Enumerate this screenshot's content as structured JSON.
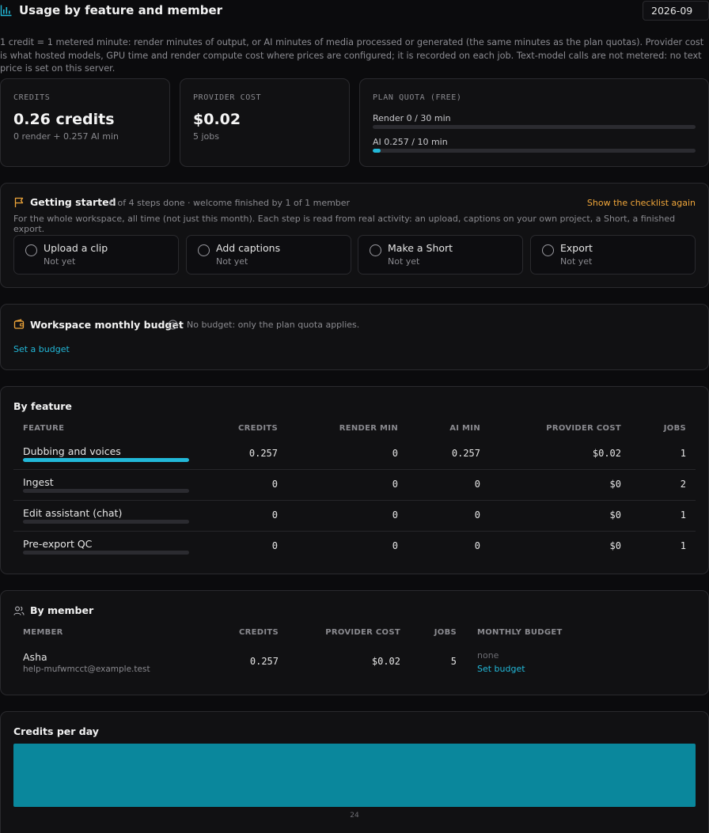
{
  "header": {
    "title": "Usage by feature and member",
    "month": "2026-09",
    "intro": "1 credit = 1 metered minute: render minutes of output, or AI minutes of media processed or generated (the same minutes as the plan quotas). Provider cost is what hosted models, GPU time and render compute cost where prices are configured; it is recorded on each job. Text-model calls are not metered: no text price is set on this server."
  },
  "stats": {
    "credits": {
      "caption": "CREDITS",
      "value": "0.26 credits",
      "sub": "0 render + 0.257 AI min"
    },
    "provider_cost": {
      "caption": "PROVIDER COST",
      "value": "$0.02",
      "sub": "5 jobs"
    },
    "plan_quota": {
      "caption": "PLAN QUOTA (FREE)",
      "render_label": "Render 0 / 30 min",
      "render_fraction": 0.0,
      "ai_label": "AI 0.257 / 10 min",
      "ai_fraction": 0.0257
    }
  },
  "getting_started": {
    "title": "Getting started",
    "progress": "0 of 4 steps done · welcome finished by 1 of 1 member",
    "show_link": "Show the checklist again",
    "description": "For the whole workspace, all time (not just this month). Each step is read from real activity: an upload, captions on your own project, a Short, a finished export.",
    "steps": [
      {
        "label": "Upload a clip",
        "status": "Not yet"
      },
      {
        "label": "Add captions",
        "status": "Not yet"
      },
      {
        "label": "Make a Short",
        "status": "Not yet"
      },
      {
        "label": "Export",
        "status": "Not yet"
      }
    ]
  },
  "budget": {
    "title": "Workspace monthly budget",
    "note": "No budget: only the plan quota applies.",
    "action": "Set a budget"
  },
  "by_feature": {
    "title": "By feature",
    "columns": [
      "FEATURE",
      "CREDITS",
      "RENDER MIN",
      "AI MIN",
      "PROVIDER COST",
      "JOBS"
    ],
    "rows": [
      {
        "feature": "Dubbing and voices",
        "credits": "0.257",
        "render_min": "0",
        "ai_min": "0.257",
        "provider_cost": "$0.02",
        "jobs": "1",
        "share": 1.0
      },
      {
        "feature": "Ingest",
        "credits": "0",
        "render_min": "0",
        "ai_min": "0",
        "provider_cost": "$0",
        "jobs": "2",
        "share": 0.0
      },
      {
        "feature": "Edit assistant (chat)",
        "credits": "0",
        "render_min": "0",
        "ai_min": "0",
        "provider_cost": "$0",
        "jobs": "1",
        "share": 0.0
      },
      {
        "feature": "Pre-export QC",
        "credits": "0",
        "render_min": "0",
        "ai_min": "0",
        "provider_cost": "$0",
        "jobs": "1",
        "share": 0.0
      }
    ]
  },
  "by_member": {
    "title": "By member",
    "columns": [
      "MEMBER",
      "CREDITS",
      "PROVIDER COST",
      "JOBS",
      "MONTHLY BUDGET"
    ],
    "rows": [
      {
        "name": "Asha",
        "email": "help-mufwmcct@example.test",
        "credits": "0.257",
        "provider_cost": "$0.02",
        "jobs": "5",
        "budget": "none",
        "budget_action": "Set budget"
      }
    ]
  },
  "credits_per_day": {
    "title": "Credits per day"
  },
  "chart_data": {
    "type": "bar",
    "categories": [
      "24"
    ],
    "values": [
      0.257
    ],
    "title": "Credits per day",
    "xlabel": "",
    "ylabel": "",
    "ylim": [
      0,
      0.257
    ],
    "grid": false,
    "colors": {
      "bar": "#0a879c"
    }
  },
  "colors": {
    "accent": "#22b8d8",
    "warning": "#f0a63a",
    "bar": "#0a879c"
  }
}
